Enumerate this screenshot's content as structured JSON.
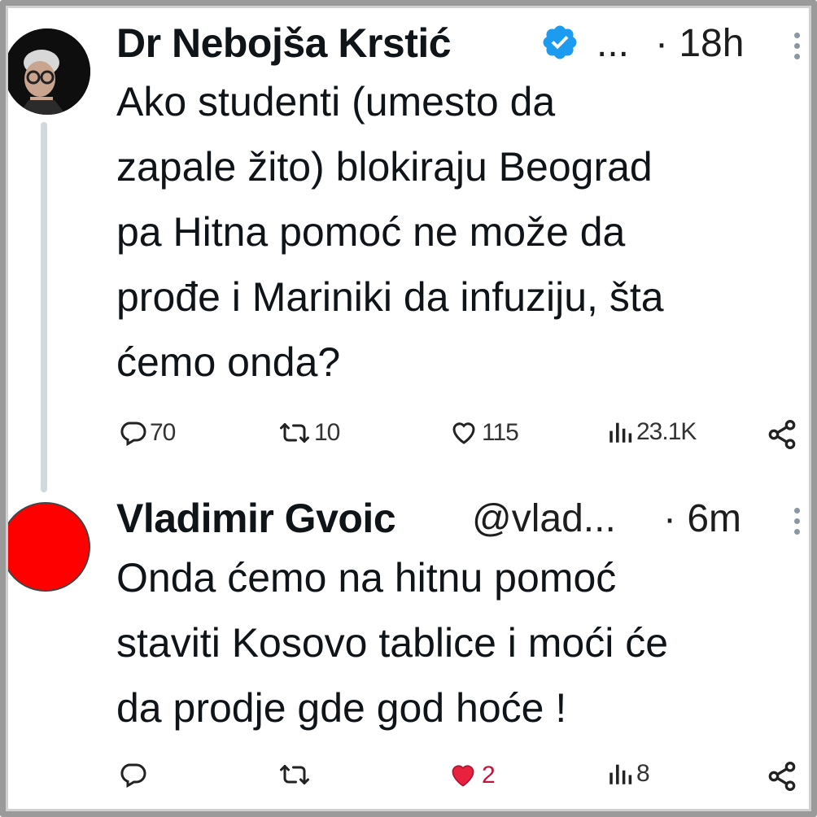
{
  "tweets": [
    {
      "name": "Dr Nebojša Krstić",
      "handle": "...",
      "time": "· 18h",
      "text": "Ako studenti (umesto da\nzapale žito) blokiraju Beograd\npa Hitna pomoć ne može da\nprođe i Mariniki da infuziju, šta\nćemo onda?",
      "replies": "70",
      "retweets": "10",
      "likes": "115",
      "views": "23.1K",
      "verified": true
    },
    {
      "name": "Vladimir Gvoic",
      "handle": "@vlad...",
      "time": "· 6m",
      "text": "Onda ćemo na hitnu pomoć\nstaviti Kosovo tablice i moći će\nda prodje gde god hoće !",
      "replies": "",
      "retweets": "",
      "likes": "2",
      "views": "8",
      "liked": true,
      "avatar_color": "#ff0000"
    }
  ],
  "colors": {
    "verified": "#1d9bf0",
    "like": "#f91880",
    "accent_like_fill": "#e8213f"
  },
  "icons": [
    "reply-icon",
    "retweet-icon",
    "like-icon",
    "views-icon",
    "share-icon",
    "more-icon",
    "verified-badge-icon"
  ]
}
